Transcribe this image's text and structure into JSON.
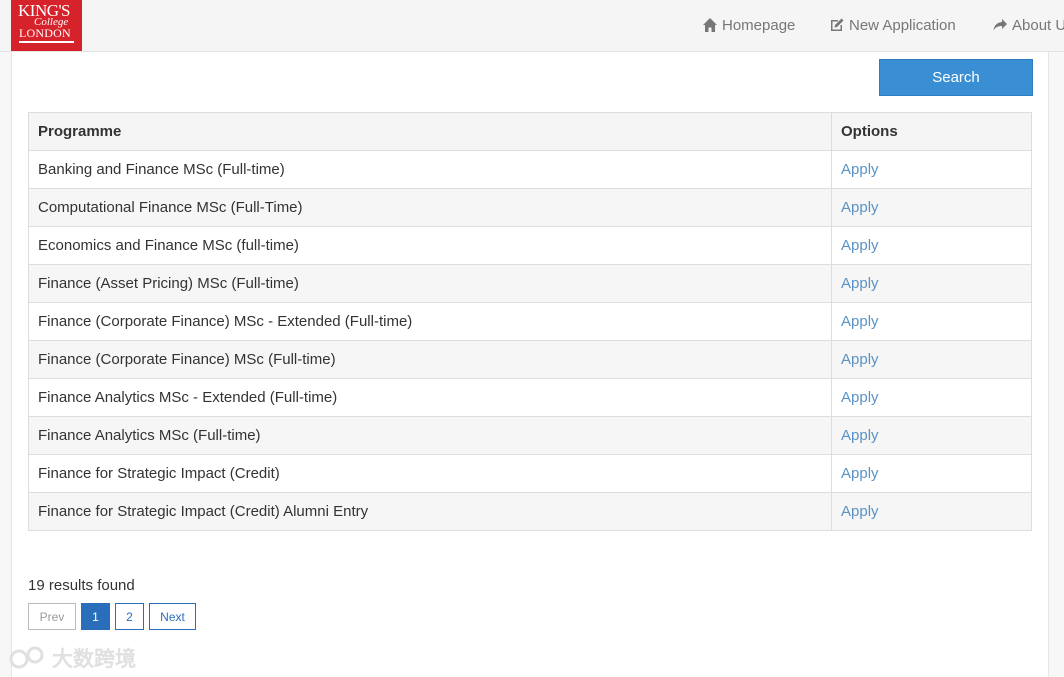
{
  "brand": {
    "line1": "KING'S",
    "line2": "College",
    "line3": "LONDON",
    "color": "#d6222a"
  },
  "nav": {
    "items": [
      {
        "label": "Homepage",
        "icon": "home-icon"
      },
      {
        "label": "New Application",
        "icon": "edit-icon"
      },
      {
        "label": "About U",
        "icon": "share-arrow-icon"
      }
    ]
  },
  "search": {
    "button_label": "Search",
    "color": "#3a8fd4"
  },
  "table": {
    "headers": [
      "Programme",
      "Options"
    ],
    "rows": [
      {
        "programme": "Banking and Finance MSc (Full-time)",
        "option": "Apply"
      },
      {
        "programme": "Computational Finance MSc (Full-Time)",
        "option": "Apply"
      },
      {
        "programme": "Economics and Finance MSc (full-time)",
        "option": "Apply"
      },
      {
        "programme": "Finance (Asset Pricing) MSc (Full-time)",
        "option": "Apply"
      },
      {
        "programme": "Finance (Corporate Finance) MSc - Extended (Full-time)",
        "option": "Apply"
      },
      {
        "programme": "Finance (Corporate Finance) MSc (Full-time)",
        "option": "Apply"
      },
      {
        "programme": "Finance Analytics MSc - Extended (Full-time)",
        "option": "Apply"
      },
      {
        "programme": "Finance Analytics MSc (Full-time)",
        "option": "Apply"
      },
      {
        "programme": "Finance for Strategic Impact (Credit)",
        "option": "Apply"
      },
      {
        "programme": "Finance for Strategic Impact (Credit) Alumni Entry",
        "option": "Apply"
      }
    ],
    "link_color": "#5b92c4"
  },
  "results": {
    "text": "19 results found"
  },
  "pagination": {
    "prev": "Prev",
    "pages": [
      "1",
      "2"
    ],
    "current": "1",
    "next": "Next"
  },
  "watermark": {
    "text": "大数跨境"
  }
}
